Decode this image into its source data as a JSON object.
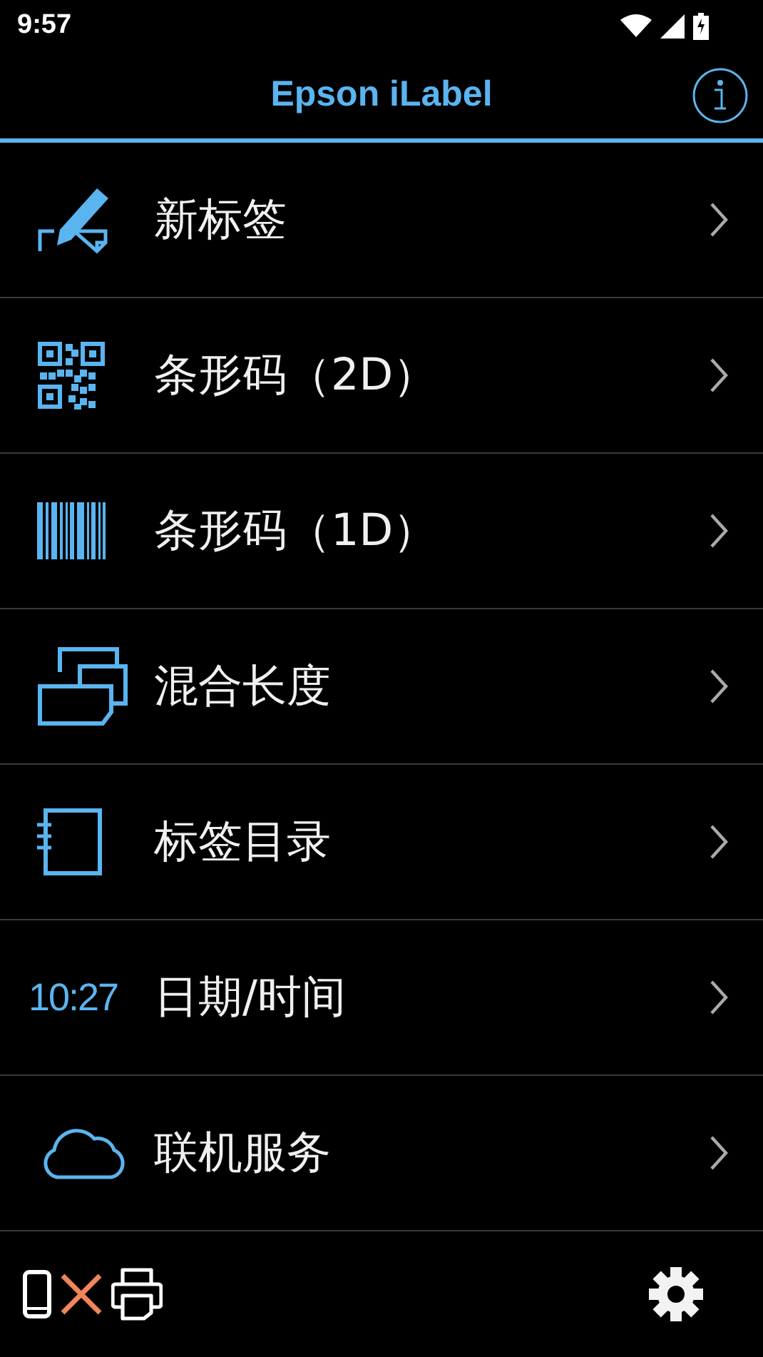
{
  "status_bar": {
    "time": "9:57"
  },
  "header": {
    "title": "Epson iLabel"
  },
  "menu": [
    {
      "kind": "pencil",
      "label": "新标签"
    },
    {
      "kind": "qr",
      "label": "条形码（2D）"
    },
    {
      "kind": "barcode",
      "label": "条形码（1D）"
    },
    {
      "kind": "stack",
      "label": "混合长度"
    },
    {
      "kind": "notebook",
      "label": "标签目录"
    },
    {
      "kind": "clock",
      "icon_text": "10:27",
      "label": "日期/时间"
    },
    {
      "kind": "cloud",
      "label": "联机服务"
    }
  ],
  "footer": {
    "printer_connected": false
  }
}
